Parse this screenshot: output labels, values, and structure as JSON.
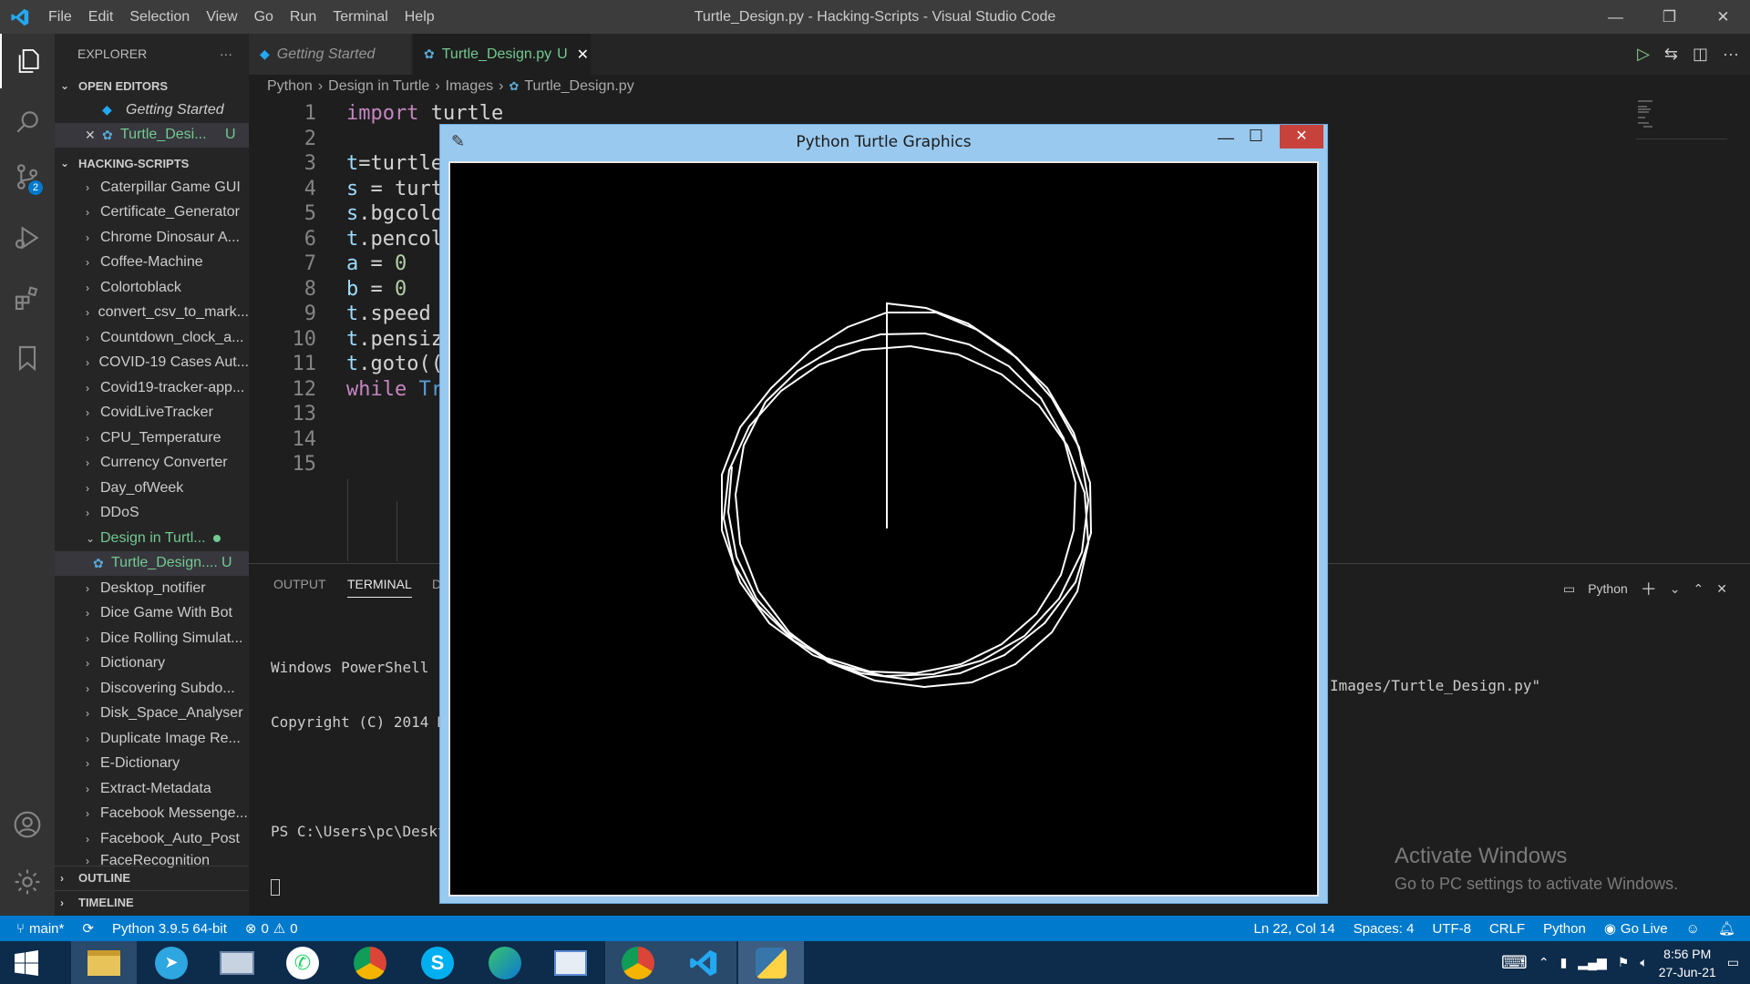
{
  "titlebar": {
    "menu": [
      "File",
      "Edit",
      "Selection",
      "View",
      "Go",
      "Run",
      "Terminal",
      "Help"
    ],
    "title": "Turtle_Design.py - Hacking-Scripts - Visual Studio Code"
  },
  "activity": {
    "scm_badge": "2"
  },
  "sidebar": {
    "header": "EXPLORER",
    "more": "···",
    "open_editors": {
      "label": "OPEN EDITORS",
      "items": [
        {
          "name": "Getting Started",
          "mark": ""
        },
        {
          "name": "Turtle_Desi...",
          "mark": "U"
        }
      ]
    },
    "workspace": {
      "label": "HACKING-SCRIPTS",
      "folders": [
        "Caterpillar Game GUI",
        "Certificate_Generator",
        "Chrome Dinosaur A...",
        "Coffee-Machine",
        "Colortoblack",
        "convert_csv_to_mark...",
        "Countdown_clock_a...",
        "COVID-19 Cases Aut...",
        "Covid19-tracker-app...",
        "CovidLiveTracker",
        "CPU_Temperature",
        "Currency Converter",
        "Day_ofWeek",
        "DDoS"
      ],
      "open_folder": "Design in Turtl...",
      "open_file": {
        "name": "Turtle_Design....",
        "mark": "U"
      },
      "folders_after": [
        "Desktop_notifier",
        "Dice Game With Bot",
        "Dice Rolling Simulat...",
        "Dictionary",
        "Discovering Subdo...",
        "Disk_Space_Analyser",
        "Duplicate Image Re...",
        "E-Dictionary",
        "Extract-Metadata",
        "Facebook Messenge...",
        "Facebook_Auto_Post",
        "FaceRecognition"
      ]
    },
    "outline": "OUTLINE",
    "timeline": "TIMELINE"
  },
  "tabs": [
    {
      "label": "Getting Started"
    },
    {
      "label": "Turtle_Design.py",
      "mark": "U",
      "close": "✕"
    }
  ],
  "breadcrumb": [
    "Python",
    "Design in Turtle",
    "Images",
    "Turtle_Design.py"
  ],
  "editor": {
    "line_numbers": [
      "1",
      "2",
      "3",
      "4",
      "5",
      "6",
      "7",
      "8",
      "9",
      "10",
      "11",
      "12",
      "13",
      "14",
      "15"
    ]
  },
  "panel": {
    "tabs": [
      "OUTPUT",
      "TERMINAL",
      "D"
    ],
    "shell_label": "Python",
    "terminal": {
      "line1": "Windows PowerShell",
      "line2": "Copyright (C) 2014 M",
      "line3": "PS C:\\Users\\pc\\Deskto",
      "line3_tail": "Images/Turtle_Design.py\""
    }
  },
  "turtle_window": {
    "title": "Python Turtle Graphics"
  },
  "watermark": {
    "line1": "Activate Windows",
    "line2": "Go to PC settings to activate Windows."
  },
  "status": {
    "branch": "main*",
    "interpreter": "Python 3.9.5 64-bit",
    "errors": "0",
    "warnings": "0",
    "position": "Ln 22, Col 14",
    "spaces": "Spaces: 4",
    "encoding": "UTF-8",
    "eol": "CRLF",
    "language": "Python",
    "golive": "Go Live"
  },
  "taskbar": {
    "time": "8:56 PM",
    "date": "27-Jun-21"
  },
  "colors": {
    "statusbar": "#007acc",
    "accent_green": "#73c991",
    "turtle_titlebar": "#99c9ef",
    "keyword": "#c586c0"
  }
}
